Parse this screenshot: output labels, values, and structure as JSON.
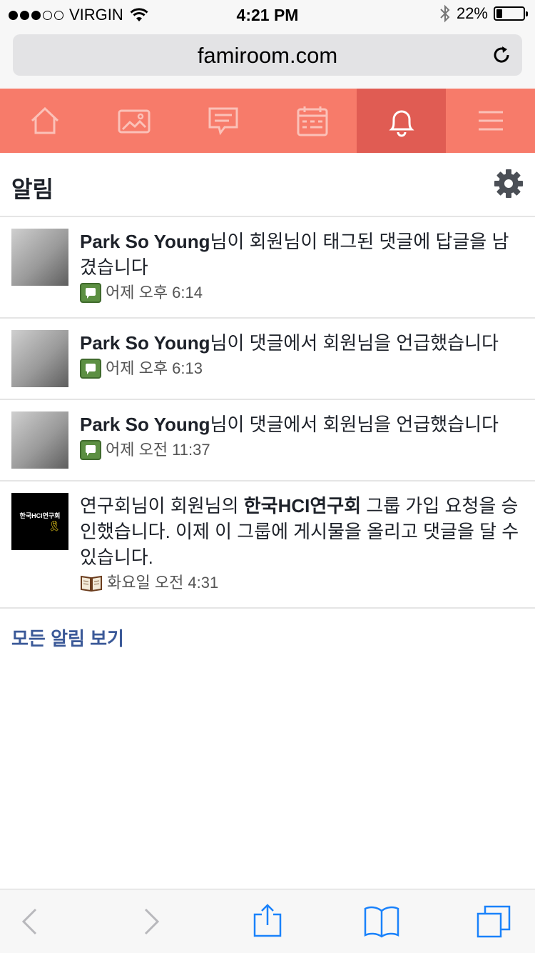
{
  "status_bar": {
    "carrier": "VIRGIN",
    "time": "4:21 PM",
    "battery": "22%",
    "battery_level": 0.22,
    "signal_bars": 3
  },
  "browser": {
    "url": "famiroom.com",
    "reload_icon": "reload-icon"
  },
  "nav": {
    "items": [
      {
        "icon": "home-icon"
      },
      {
        "icon": "photo-icon"
      },
      {
        "icon": "chat-icon"
      },
      {
        "icon": "calendar-icon"
      },
      {
        "icon": "bell-icon",
        "active": true
      },
      {
        "icon": "menu-icon"
      }
    ],
    "background": "#f77b6a",
    "active_background": "#e05c53"
  },
  "header": {
    "title": "알림",
    "settings_icon": "gear-icon"
  },
  "notifications": [
    {
      "actor": "Park So Young",
      "text": "님이 회원님이 태그된 댓글에 답글을 남겼습니다",
      "icon": "comment-icon",
      "time": "어제 오후 6:14"
    },
    {
      "actor": "Park So Young",
      "text": "님이 댓글에서 회원님을 언급했습니다",
      "icon": "comment-icon",
      "time": "어제 오후 6:13"
    },
    {
      "actor": "Park So Young",
      "text": "님이 댓글에서 회원님을 언급했습니다",
      "icon": "comment-icon",
      "time": "어제 오전 11:37"
    },
    {
      "prefix": "연구회님이 회원님의 ",
      "group": "한국HCI연구회",
      "text": " 그룹 가입 요청을 승인했습니다. 이제 이 그룹에 게시물을 올리고 댓글을 달 수 있습니다.",
      "icon": "book-icon",
      "time": "화요일 오전 4:31",
      "avatar_text": "한국HCI연구회"
    }
  ],
  "see_all": "모든 알림 보기",
  "link_color": "#3b5998",
  "toolbar": {
    "items": [
      "back-icon",
      "forward-icon",
      "share-icon",
      "bookmarks-icon",
      "tabs-icon"
    ]
  }
}
